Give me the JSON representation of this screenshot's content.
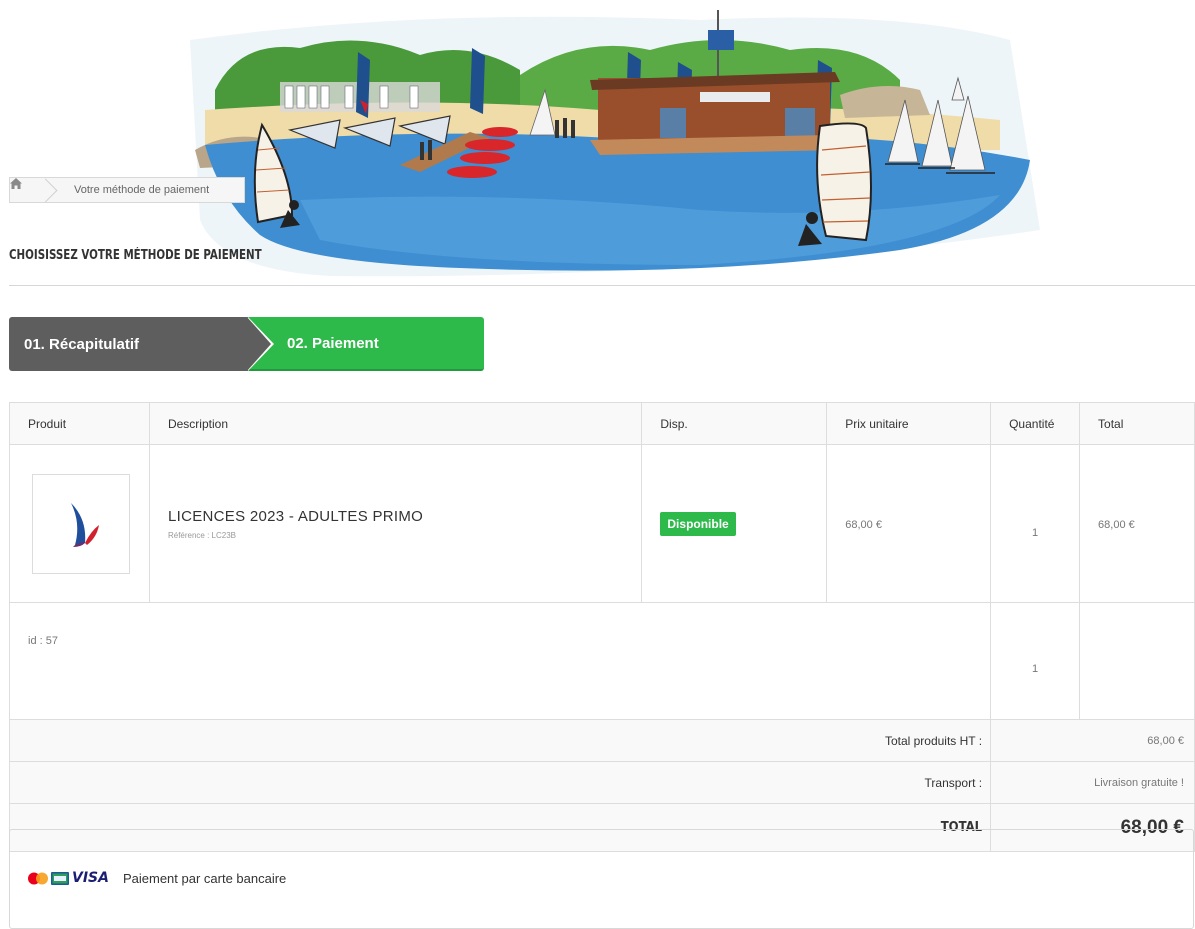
{
  "breadcrumb": {
    "home_icon": "home-icon",
    "current": "Votre méthode de paiement"
  },
  "page_title": "CHOISISSEZ VOTRE MÉTHODE DE PAIEMENT",
  "steps": [
    {
      "label": "01. Récapitulatif",
      "state": "done",
      "color": "#5f5e5e"
    },
    {
      "label": "02. Paiement",
      "state": "active",
      "color": "#2eb94b"
    }
  ],
  "cart": {
    "headers": [
      "Produit",
      "Description",
      "Disp.",
      "Prix unitaire",
      "Quantité",
      "Total"
    ],
    "product": {
      "name": "LICENCES 2023 - ADULTES PRIMO",
      "reference": "Référence : LC23B",
      "availability": "Disponible",
      "unit_price": "68,00 €",
      "quantity": "1",
      "total": "68,00 €"
    },
    "sub_row": {
      "id_text": "id : 57",
      "quantity": "1"
    },
    "summary": {
      "products_ht_label": "Total produits HT :",
      "products_ht_value": "68,00 €",
      "shipping_label": "Transport :",
      "shipping_value": "Livraison gratuite !",
      "total_label": "TOTAL",
      "total_value": "68,00 €"
    }
  },
  "payment": {
    "card_brand": "VISA",
    "label": "Paiement par carte bancaire"
  }
}
